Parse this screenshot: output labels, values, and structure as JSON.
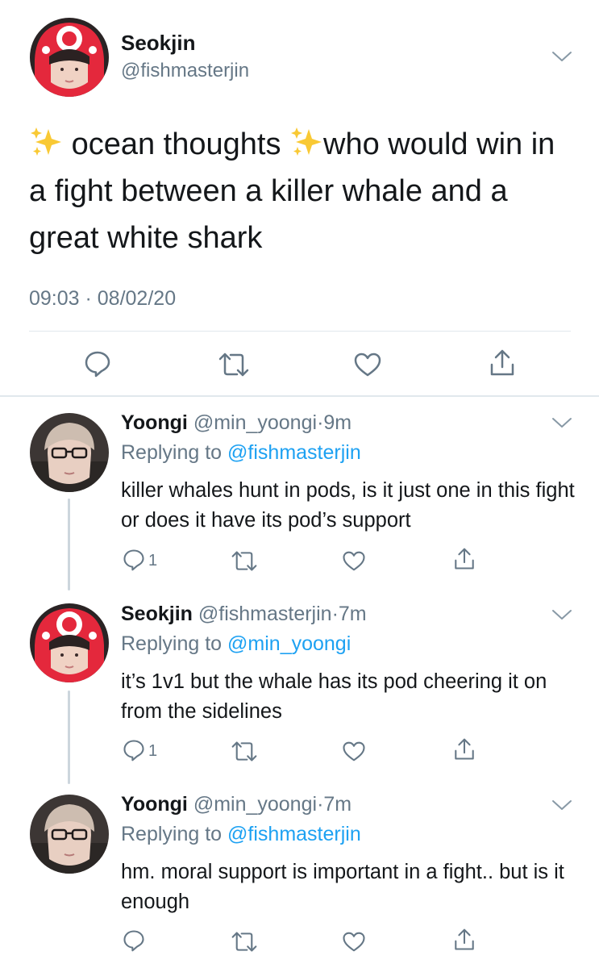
{
  "main_tweet": {
    "name": "Seokjin",
    "handle": "@fishmasterjin",
    "text_part1": "ocean thoughts",
    "text_part2": "who would win in a fight between a killer whale and a great white shark",
    "timestamp": "09:03 · 08/02/20",
    "sparkle_icon": "sparkles-emoji"
  },
  "replies": [
    {
      "name": "Yoongi",
      "handle": "@min_yoongi",
      "sep": "·",
      "time": "9m",
      "replying_prefix": "Replying to",
      "replying_to": "@fishmasterjin",
      "text": "killer whales hunt in pods, is it just one in this fight or does it have its pod’s support",
      "reply_count": "1"
    },
    {
      "name": "Seokjin",
      "handle": "@fishmasterjin",
      "sep": "·",
      "time": "7m",
      "replying_prefix": "Replying to",
      "replying_to": "@min_yoongi",
      "text": "it’s 1v1 but the whale has its pod cheering it on from the sidelines",
      "reply_count": "1"
    },
    {
      "name": "Yoongi",
      "handle": "@min_yoongi",
      "sep": "·",
      "time": "7m",
      "replying_prefix": "Replying to",
      "replying_to": "@fishmasterjin",
      "text": "hm. moral support is important in a fight.. but is it enough",
      "reply_count": ""
    }
  ],
  "colors": {
    "text": "#14171a",
    "muted": "#657786",
    "link": "#1da1f2",
    "divider": "#e1e8ed",
    "icon": "#657786"
  }
}
